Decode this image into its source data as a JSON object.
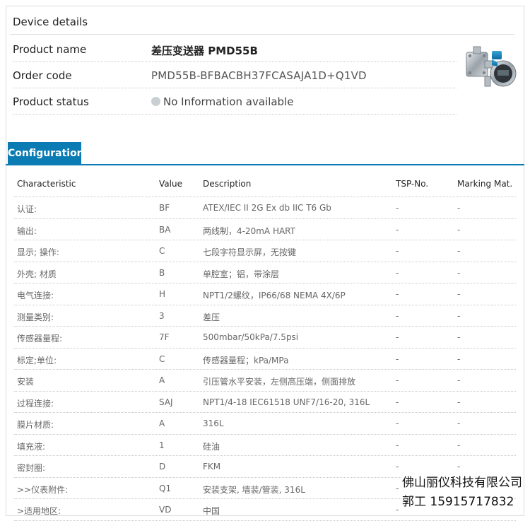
{
  "device_details": {
    "title": "Device details",
    "rows": [
      {
        "label": "Product name",
        "value": "差压变送器 PMD55B"
      },
      {
        "label": "Order code",
        "value": "PMD55B-BFBACBH37FCASAJA1D+Q1VD"
      },
      {
        "label": "Product status",
        "value": "No Information available"
      }
    ]
  },
  "configuration": {
    "tab_label": "Configuration",
    "headers": [
      "Characteristic",
      "Value",
      "Description",
      "TSP-No.",
      "Marking Mat."
    ],
    "rows": [
      [
        "认证:",
        "BF",
        "ATEX/IEC II 2G Ex db IIC T6 Gb",
        "-",
        "-"
      ],
      [
        "输出:",
        "BA",
        "两线制，4-20mA HART",
        "-",
        "-"
      ],
      [
        "显示; 操作:",
        "C",
        "七段字符显示屏，无按键",
        "-",
        "-"
      ],
      [
        "外壳; 材质",
        "B",
        "单腔室；铝，带涂层",
        "-",
        "-"
      ],
      [
        "电气连接:",
        "H",
        "NPT1/2螺纹，IP66/68 NEMA 4X/6P",
        "-",
        "-"
      ],
      [
        "测量类别:",
        "3",
        "差压",
        "-",
        "-"
      ],
      [
        "传感器量程:",
        "7F",
        "500mbar/50kPa/7.5psi",
        "-",
        "-"
      ],
      [
        "标定;单位:",
        "C",
        "传感器量程；kPa/MPa",
        "-",
        "-"
      ],
      [
        "安装",
        "A",
        "引压管水平安装，左侧高压端，侧面排放",
        "-",
        "-"
      ],
      [
        "过程连接:",
        "SAJ",
        "NPT1/4-18 IEC61518 UNF7/16-20, 316L",
        "-",
        "-"
      ],
      [
        "膜片材质:",
        "A",
        "316L",
        "-",
        "-"
      ],
      [
        "填充液:",
        "1",
        "硅油",
        "-",
        "-"
      ],
      [
        "密封圈:",
        "D",
        "FKM",
        "-",
        "-"
      ],
      [
        ">>仪表附件:",
        "Q1",
        "安装支架, 墙装/管装, 316L",
        "-",
        ""
      ],
      [
        ">适用地区:",
        "VD",
        "中国",
        "-",
        ""
      ]
    ]
  },
  "watermark": {
    "company": "佛山丽仪科技有限公司",
    "contact": "郭工 15915717832"
  },
  "colors": {
    "accent": "#0a7bb3",
    "status_dot": "#c9cfd3"
  },
  "icons": {
    "status": "status-dot-icon",
    "device": "pressure-transmitter-image"
  }
}
